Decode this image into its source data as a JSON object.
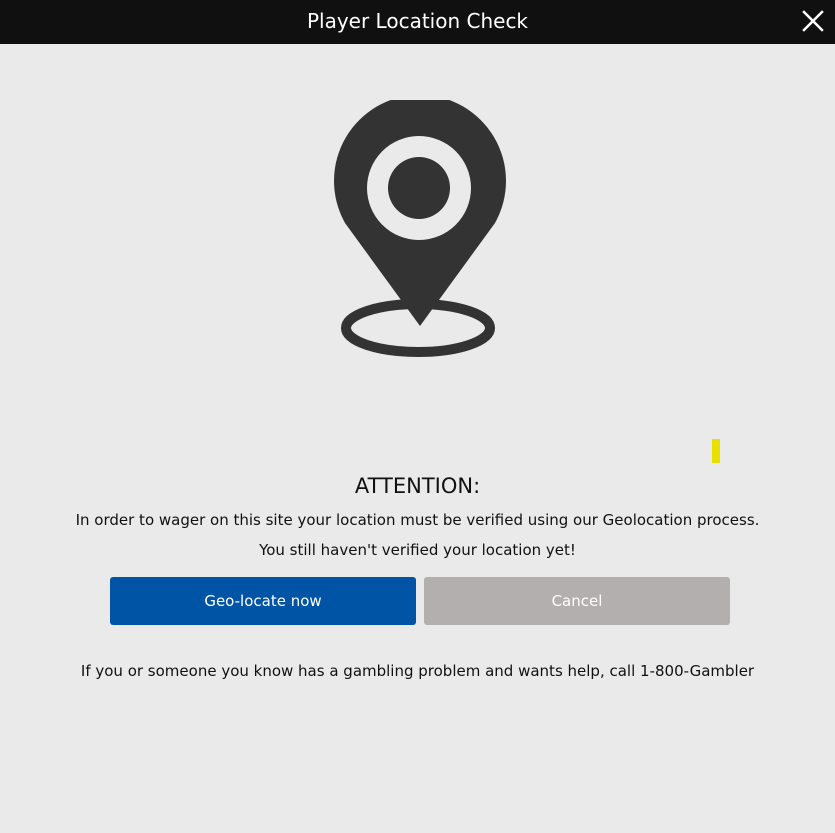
{
  "dialog": {
    "title": "Player Location Check",
    "close_icon": "close-icon"
  },
  "hero": {
    "icon": "location-pin-icon",
    "icon_color": "#333333",
    "marker_color": "#e9e000"
  },
  "message": {
    "heading": "ATTENTION:",
    "line1": "In order to wager on this site your location must be verified using our Geolocation process.",
    "line2": "You still haven't verified your location yet!"
  },
  "actions": {
    "geolocate_label": "Geo-locate now",
    "geolocate_color": "#0054a6",
    "cancel_label": "Cancel",
    "cancel_color": "#b4afaf"
  },
  "footer": {
    "help_text": "If you or someone you know has a gambling problem and wants help, call 1-800-Gambler"
  }
}
